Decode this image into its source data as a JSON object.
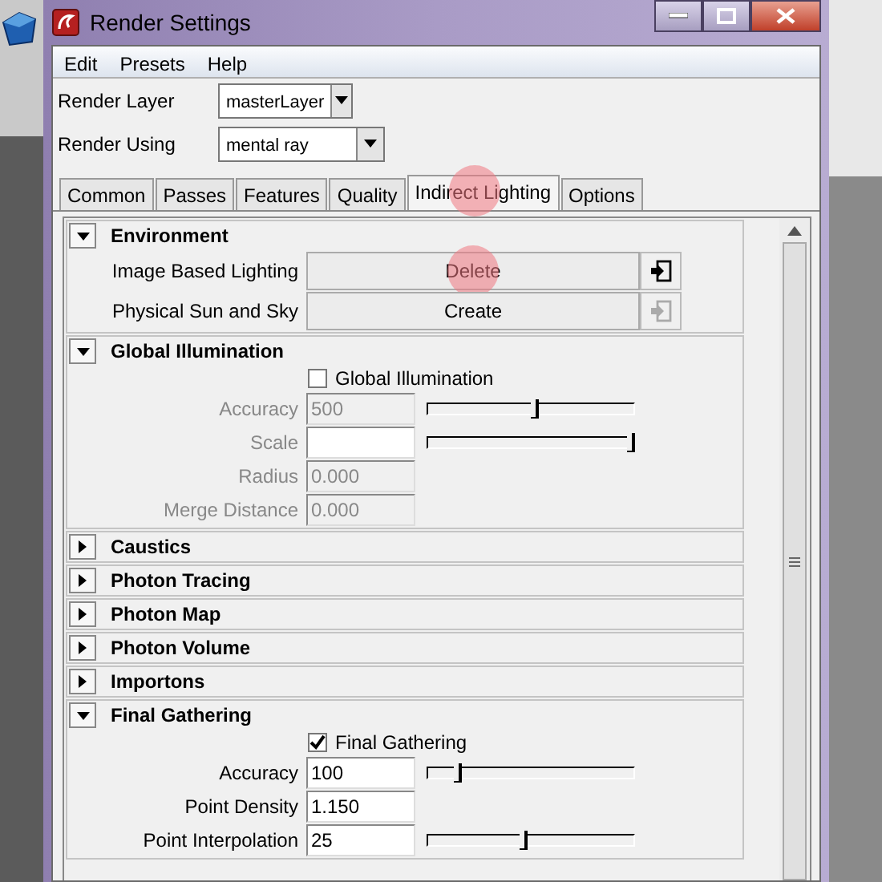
{
  "window": {
    "title": "Render Settings"
  },
  "menu": [
    "Edit",
    "Presets",
    "Help"
  ],
  "selectors": [
    {
      "label": "Render Layer",
      "value": "masterLayer"
    },
    {
      "label": "Render Using",
      "value": "mental ray"
    }
  ],
  "tabs": [
    {
      "label": "Common",
      "selected": false,
      "highlighted": false
    },
    {
      "label": "Passes",
      "selected": false,
      "highlighted": false
    },
    {
      "label": "Features",
      "selected": false,
      "highlighted": false
    },
    {
      "label": "Quality",
      "selected": false,
      "highlighted": false
    },
    {
      "label": "Indirect Lighting",
      "selected": true,
      "highlighted": true
    },
    {
      "label": "Options",
      "selected": false,
      "highlighted": false
    }
  ],
  "sections": [
    {
      "title": "Environment",
      "expanded": true,
      "items": [
        {
          "kind": "button_row",
          "label": "Image Based Lighting",
          "button": "Delete",
          "highlighted": true,
          "icon_enabled": true
        },
        {
          "kind": "button_row",
          "label": "Physical Sun and Sky",
          "button": "Create",
          "highlighted": false,
          "icon_enabled": false
        }
      ]
    },
    {
      "title": "Global Illumination",
      "expanded": true,
      "items": [
        {
          "kind": "checkbox",
          "label": "Global Illumination",
          "checked": false
        },
        {
          "kind": "field",
          "label": "Accuracy",
          "value": "500",
          "disabled": true,
          "level": 0.52
        },
        {
          "kind": "field",
          "label": "Scale",
          "disabled": true,
          "level": 1.0
        },
        {
          "kind": "field",
          "label": "Radius",
          "value": "0.000",
          "disabled": true
        },
        {
          "kind": "field",
          "label": "Merge Distance",
          "value": "0.000",
          "disabled": true
        }
      ]
    },
    {
      "title": "Caustics",
      "expanded": false
    },
    {
      "title": "Photon Tracing",
      "expanded": false
    },
    {
      "title": "Photon Map",
      "expanded": false
    },
    {
      "title": "Photon Volume",
      "expanded": false
    },
    {
      "title": "Importons",
      "expanded": false
    },
    {
      "title": "Final Gathering",
      "expanded": true,
      "items": [
        {
          "kind": "checkbox",
          "label": "Final Gathering",
          "checked": true
        },
        {
          "kind": "field",
          "label": "Accuracy",
          "value": "100",
          "disabled": false,
          "level": 0.13
        },
        {
          "kind": "field",
          "label": "Point Density",
          "value": "1.150",
          "disabled": false
        },
        {
          "kind": "field",
          "label": "Point Interpolation",
          "value": "25",
          "disabled": false,
          "level": 0.46
        }
      ]
    }
  ]
}
